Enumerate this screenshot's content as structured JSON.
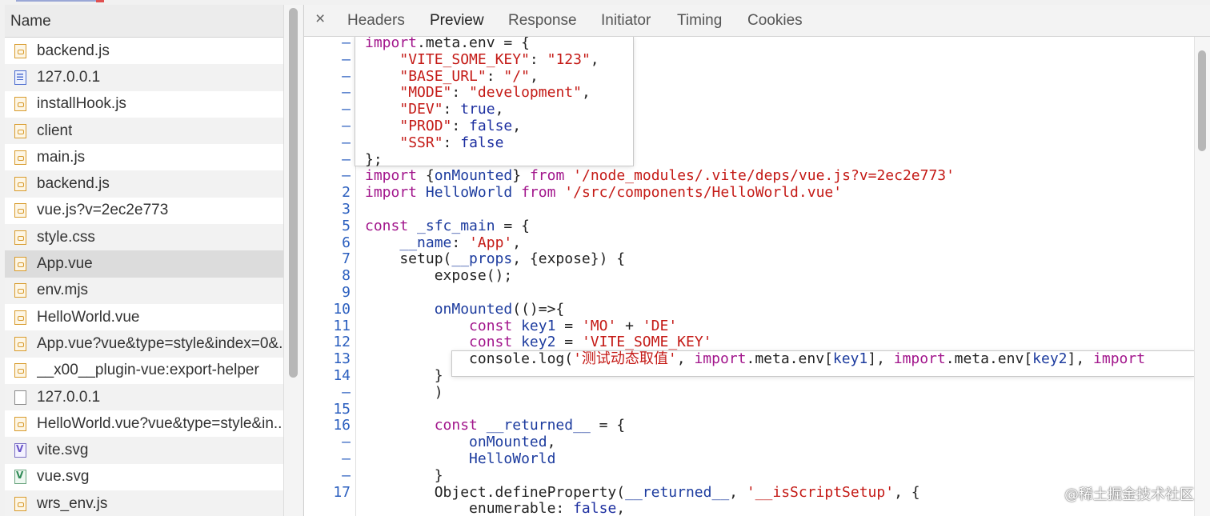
{
  "network_panel": {
    "column_header": "Name",
    "files": [
      {
        "name": "backend.js",
        "icon": "js-file-icon"
      },
      {
        "name": "127.0.0.1",
        "icon": "document-icon"
      },
      {
        "name": "installHook.js",
        "icon": "js-file-icon"
      },
      {
        "name": "client",
        "icon": "js-file-icon"
      },
      {
        "name": "main.js",
        "icon": "js-file-icon"
      },
      {
        "name": "backend.js",
        "icon": "js-file-icon"
      },
      {
        "name": "vue.js?v=2ec2e773",
        "icon": "js-file-icon"
      },
      {
        "name": "style.css",
        "icon": "js-file-icon"
      },
      {
        "name": "App.vue",
        "icon": "js-file-icon",
        "selected": true
      },
      {
        "name": "env.mjs",
        "icon": "js-file-icon"
      },
      {
        "name": "HelloWorld.vue",
        "icon": "js-file-icon"
      },
      {
        "name": "App.vue?vue&type=style&index=0&.",
        "icon": "js-file-icon"
      },
      {
        "name": "__x00__plugin-vue:export-helper",
        "icon": "js-file-icon"
      },
      {
        "name": "127.0.0.1",
        "icon": "blank-file-icon"
      },
      {
        "name": "HelloWorld.vue?vue&type=style&in..",
        "icon": "js-file-icon"
      },
      {
        "name": "vite.svg",
        "icon": "svg-purple-icon"
      },
      {
        "name": "vue.svg",
        "icon": "svg-green-icon"
      },
      {
        "name": "wrs_env.js",
        "icon": "js-file-icon"
      }
    ]
  },
  "detail_panel": {
    "close_label": "×",
    "tabs": [
      "Headers",
      "Preview",
      "Response",
      "Initiator",
      "Timing",
      "Cookies"
    ],
    "active_tab": "Preview"
  },
  "code": {
    "line_numbers": [
      "–",
      "–",
      "–",
      "–",
      "–",
      "–",
      "–",
      "–",
      "–",
      "2",
      "3",
      "5",
      "6",
      "7",
      "8",
      "9",
      "10",
      "11",
      "12",
      "13",
      "14",
      "–",
      "15",
      "16",
      "–",
      "–",
      "–",
      "17"
    ],
    "lines": [
      "import.meta.env = {",
      "    \"VITE_SOME_KEY\": \"123\",",
      "    \"BASE_URL\": \"/\",",
      "    \"MODE\": \"development\",",
      "    \"DEV\": true,",
      "    \"PROD\": false,",
      "    \"SSR\": false",
      "};",
      "import {onMounted} from '/node_modules/.vite/deps/vue.js?v=2ec2e773'",
      "import HelloWorld from '/src/components/HelloWorld.vue'",
      "",
      "const _sfc_main = {",
      "    __name: 'App',",
      "    setup(__props, {expose}) {",
      "        expose();",
      "",
      "        onMounted(()=>{",
      "            const key1 = 'MO' + 'DE'",
      "            const key2 = 'VITE_SOME_KEY'",
      "            console.log('测试动态取值', import.meta.env[key1], import.meta.env[key2], import",
      "        }",
      "        )",
      "",
      "        const __returned__ = {",
      "            onMounted,",
      "            HelloWorld",
      "        }",
      "        Object.defineProperty(__returned__, '__isScriptSetup', {",
      "            enumerable: false,"
    ]
  },
  "watermark": "@稀土掘金技术社区",
  "colors": {
    "keyword": "#a2168c",
    "keyword_blue": "#1d2fa0",
    "string": "#c41a16",
    "line_number": "#2b5fbf"
  }
}
